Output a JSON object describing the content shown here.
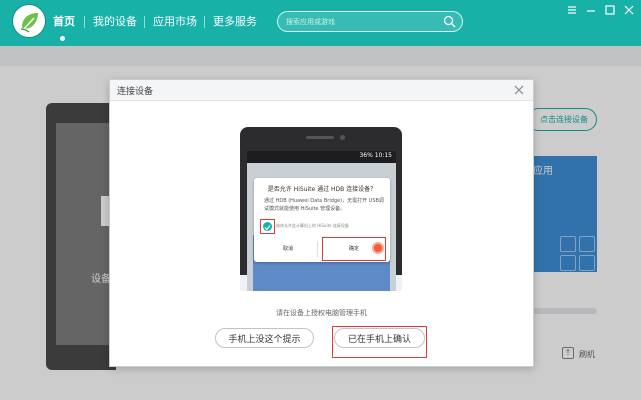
{
  "topbar": {
    "color": "#17b1a8",
    "logo_icon": "hisuite-leaf-icon",
    "nav": [
      {
        "label": "首页",
        "active": true
      },
      {
        "label": "我的设备",
        "active": false
      },
      {
        "label": "应用市场",
        "active": false
      },
      {
        "label": "更多服务",
        "active": false
      }
    ],
    "search_placeholder": "搜索应用或游戏",
    "window_controls": [
      "menu-icon",
      "minimize-icon",
      "maximize-icon",
      "close-icon"
    ]
  },
  "background": {
    "connect_button_label": "点击连接设备",
    "phone_label": "设备",
    "app_card_label": "应用",
    "side_hint_label": "刷机"
  },
  "dialog": {
    "title": "连接设备",
    "phone_status": "36% 10:15",
    "prompt": {
      "title": "是否允许 HiSuite 通过 HDB 连接设备？",
      "body": "通过 HDB (Huawei Data Bridge)，无需打开 USB调试模式就能使用 HiSuite 管理设备。",
      "checkbox_label": "始终允许此计算机上的 HiSuite 连接设备",
      "cancel": "取消",
      "ok": "确定"
    },
    "instruction": "请在设备上授权电脑管理手机",
    "button_no_prompt": "手机上没这个提示",
    "button_confirmed": "已在手机上确认",
    "highlight_color": "#e53935"
  }
}
